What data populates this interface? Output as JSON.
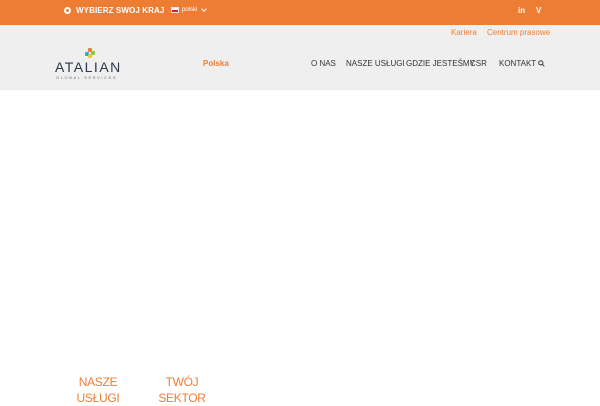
{
  "topbar": {
    "country_label": "WYBIERZ SWOJ KRAJ",
    "language": "polski",
    "social_icons": [
      "linkedin-icon",
      "vimeo-icon"
    ],
    "social_glyphs": {
      "linkedin": "in",
      "vimeo": "V"
    }
  },
  "utility_links": {
    "careers": "Kariera",
    "press": "Centrum prasowe"
  },
  "logo": {
    "name": "ATALIAN",
    "tagline": "GLOBAL SERVICES"
  },
  "site_label": "Polska",
  "nav": {
    "about": "O NAS",
    "services": "NASZE USŁUGI",
    "locations": "GDZIE JESTEŚMY",
    "csr": "CSR",
    "contact": "KONTAKT"
  },
  "tiles": {
    "services_line1": "NASZE",
    "services_line2": "USŁUGI",
    "sector_line1": "TWÓJ",
    "sector_line2": "SEKTOR"
  },
  "colors": {
    "accent": "#ee7d34",
    "header_bg": "#efefef",
    "text": "#333333",
    "logo_text": "#2c3a4d"
  }
}
